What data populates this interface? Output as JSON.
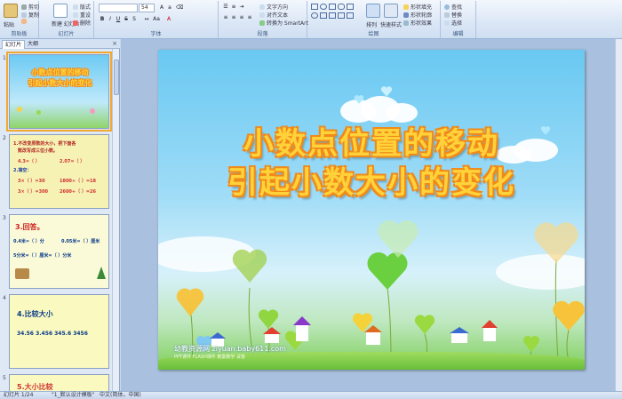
{
  "ribbon": {
    "clipboard": {
      "paste": "粘贴",
      "cut": "剪切",
      "copy": "复制",
      "format_painter": "格式刷",
      "label": "剪贴板"
    },
    "slides": {
      "new_slide": "新建\n幻灯片",
      "layout": "版式",
      "reset": "重设",
      "delete": "删除",
      "label": "幻灯片"
    },
    "font": {
      "font_name": "",
      "font_size": "54",
      "bold": "B",
      "italic": "I",
      "underline": "U",
      "strike": "S",
      "shadow": "S",
      "label": "字体"
    },
    "paragraph": {
      "text_direction": "文字方向",
      "align_text": "对齐文本",
      "convert_smartart": "转换为 SmartArt",
      "label": "段落"
    },
    "drawing": {
      "arrange": "排列",
      "quick_styles": "快速样式",
      "shape_fill": "形状填充",
      "shape_outline": "形状轮廓",
      "shape_effects": "形状效果",
      "label": "绘图"
    },
    "editing": {
      "find": "查找",
      "replace": "替换",
      "select": "选择",
      "label": "编辑"
    }
  },
  "left_panel": {
    "tabs": [
      "幻灯片",
      "大纲"
    ],
    "close": "×",
    "thumbnails": [
      {
        "num": "1",
        "title1": "小数点位置的移动",
        "title2": "引起小数大小的变化"
      },
      {
        "num": "2",
        "line1": "1.不改变原数的大小，把下面各",
        "line2": "数改写成三位小数。",
        "row1a": "4.3=（   ）",
        "row1b": "2.07=（   ）",
        "line3": "2.填空：",
        "row2a": "3×（   ）=30",
        "row2b": "1800÷（   ）=18",
        "row3a": "3×（   ）=300",
        "row3b": "2600÷（   ）=26"
      },
      {
        "num": "3",
        "heading": "3.回答。",
        "row1a": "0.4米=（  ）分",
        "row1b": "0.05米=（  ）厘米",
        "row2": "5分米=（  ）厘米=（  ）分米"
      },
      {
        "num": "4",
        "heading": "4.比较大小",
        "values": "34.56   3.456   345.6   3456"
      },
      {
        "num": "5",
        "heading": "5.大小比较"
      }
    ]
  },
  "slide": {
    "title_line1": "小数点位置的移动",
    "title_line2": "引起小数大小的变化",
    "watermark": "幼教资源网 ziyuan.baby611.com",
    "watermark_sub": "PPT课件  FLASH课件  教案教学  试卷"
  },
  "status_bar": {
    "slide_info": "幻灯片 1/24",
    "theme": "\"1_默认设计模板\"",
    "language": "中文(简体，中国)"
  },
  "colors": {
    "title_fill": "#ffd23a",
    "title_outline": "#f08a1a",
    "sky": "#69c8f2",
    "grass": "#7fcf5a"
  }
}
